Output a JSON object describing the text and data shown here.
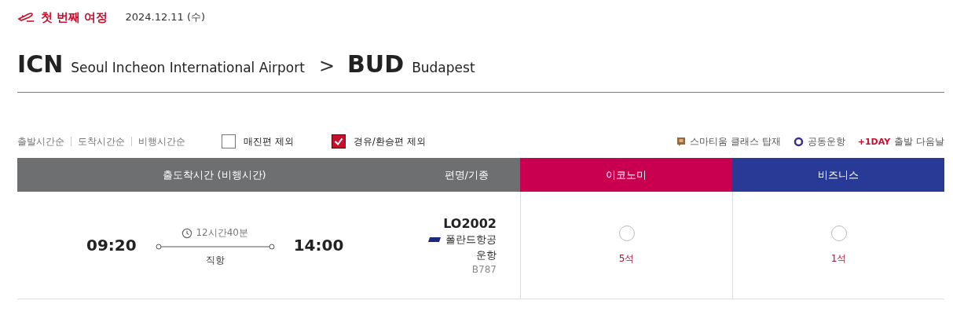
{
  "journey": {
    "title": "첫 번째 여정",
    "date": "2024.12.11 (수)"
  },
  "route": {
    "origin": {
      "code": "ICN",
      "name": "Seoul Incheon International Airport"
    },
    "separator": ">",
    "destination": {
      "code": "BUD",
      "name": "Budapest"
    }
  },
  "sort_options": [
    {
      "label": "출발시간순",
      "selected": false
    },
    {
      "label": "도착시간순",
      "selected": false
    },
    {
      "label": "비행시간순",
      "selected": false
    }
  ],
  "filters": [
    {
      "label": "매진편 제외",
      "checked": false
    },
    {
      "label": "경유/환승편 제외",
      "checked": true
    }
  ],
  "legend": [
    {
      "kind": "smartium",
      "label": "스마티움 클래스 탑재"
    },
    {
      "kind": "codeshare",
      "label": "공동운항"
    },
    {
      "kind": "nextday",
      "badge": "+1DAY",
      "label": "출발 다음날"
    }
  ],
  "table": {
    "columns": [
      {
        "label": "출도착시간 (비행시간)",
        "kind": "time"
      },
      {
        "label": "편명/기종",
        "kind": "flight"
      },
      {
        "label": "이코노미",
        "kind": "economy"
      },
      {
        "label": "비즈니스",
        "kind": "business"
      }
    ],
    "rows": [
      {
        "departure": "09:20",
        "duration": "12시간40분",
        "arrival": "14:00",
        "stops": "직항",
        "flight_no": "LO2002",
        "airline": "폴란드항공",
        "operated": "운항",
        "aircraft": "B787",
        "fares": [
          {
            "seats": "5석",
            "selected": false
          },
          {
            "seats": "1석",
            "selected": false
          }
        ]
      }
    ]
  }
}
